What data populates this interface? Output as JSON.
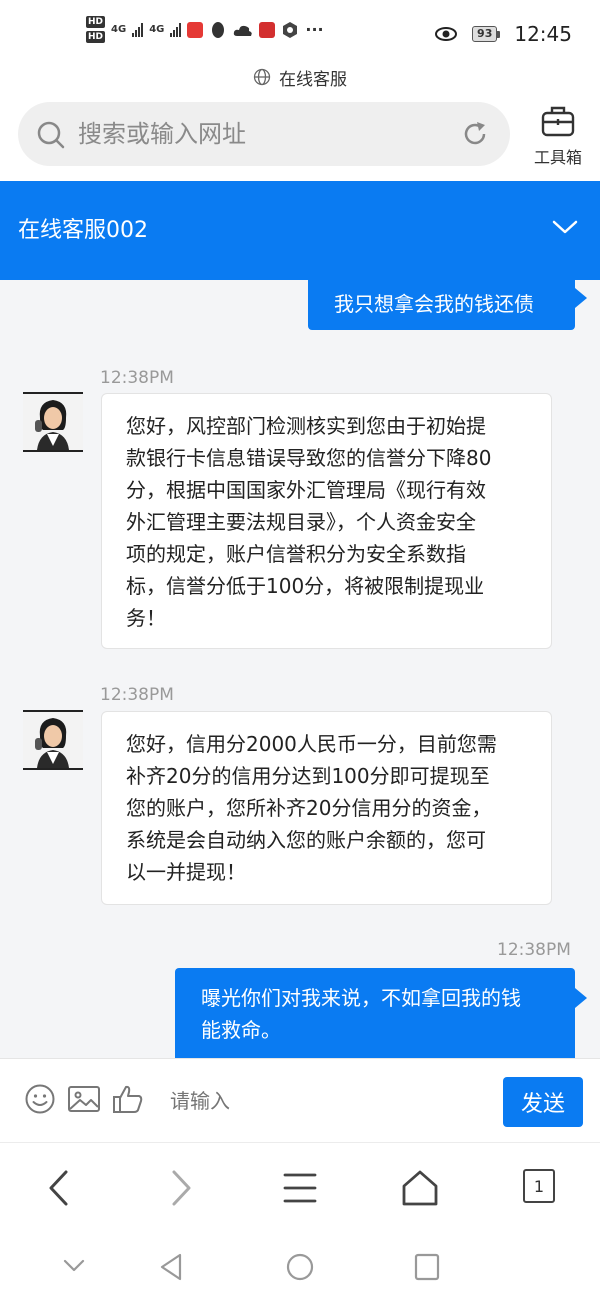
{
  "status_bar": {
    "net_label_1": "4G",
    "net_label_2": "4G",
    "battery": "93",
    "time": "12:45"
  },
  "page_header": {
    "label": "在线客服"
  },
  "browser": {
    "search_placeholder": "搜索或输入网址",
    "toolbox_label": "工具箱"
  },
  "chat": {
    "title": "在线客服002",
    "messages": [
      {
        "direction": "outgoing",
        "text": "我只想拿会我的钱还债"
      },
      {
        "direction": "incoming",
        "time": "12:38PM",
        "lines": [
          "您好，风控部门检测核实到您由于初始提",
          "款银行卡信息错误导致您的信誉分下降80",
          "分，根据中国国家外汇管理局《现行有效",
          "外汇管理主要法规目录》，个人资金安全",
          "项的规定，账户信誉积分为安全系数指",
          "标，信誉分低于100分，将被限制提现业",
          "务！"
        ]
      },
      {
        "direction": "incoming",
        "time": "12:38PM",
        "lines": [
          "您好，信用分2000人民币一分，目前您需",
          "补齐20分的信用分达到100分即可提现至",
          "您的账户，您所补齐20分信用分的资金，",
          "系统是会自动纳入您的账户余额的，您可",
          "以一并提现！"
        ]
      },
      {
        "direction": "outgoing",
        "time": "12:38PM",
        "lines": [
          "曝光你们对我来说，不如拿回我的钱",
          "能救命。"
        ]
      }
    ]
  },
  "input_bar": {
    "placeholder": "请输入",
    "send_label": "发送"
  },
  "browser_nav": {
    "tab_count": "1"
  },
  "colors": {
    "accent": "#0a7bf2",
    "background": "#f4f5f7"
  }
}
